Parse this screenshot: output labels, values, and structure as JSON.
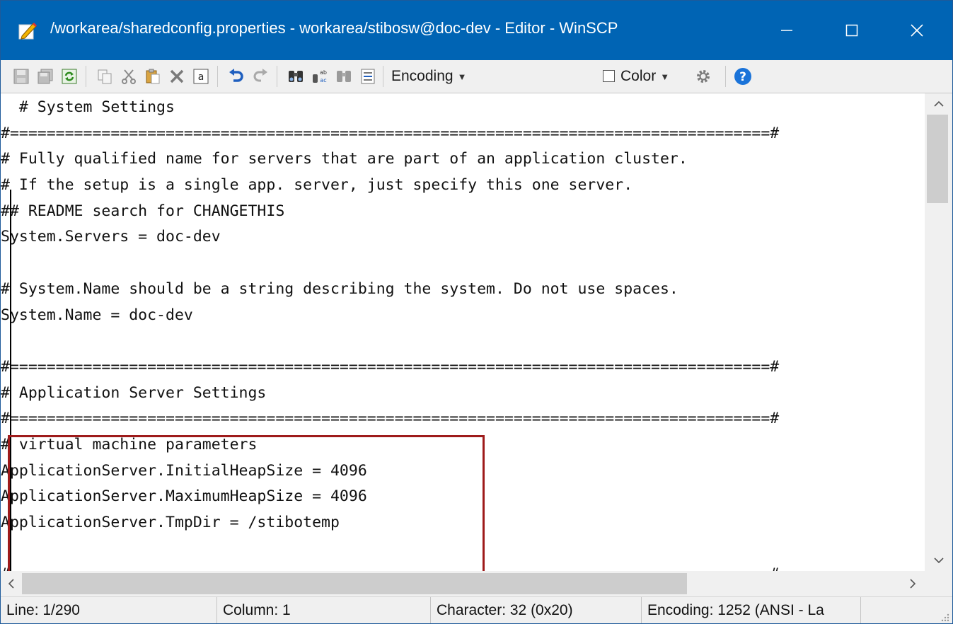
{
  "window": {
    "title": "/workarea/sharedconfig.properties - workarea/stibosw@doc-dev - Editor - WinSCP",
    "icon": "edit-pencil-icon",
    "controls": [
      "minimize-icon",
      "maximize-icon",
      "close-icon"
    ]
  },
  "toolbar": {
    "icons": [
      "save-icon",
      "save-all-icon",
      "reload-icon",
      "copy-icon",
      "cut-icon",
      "paste-icon",
      "delete-icon",
      "select-all-icon",
      "undo-icon",
      "redo-icon",
      "find-icon",
      "replace-icon",
      "find-next-icon",
      "goto-line-icon",
      "preferences-gear-icon",
      "help-icon"
    ],
    "encoding_label": "Encoding",
    "color_label": "Color"
  },
  "editor": {
    "lines": [
      "  # System Settings",
      "#===================================================================================#",
      "# Fully qualified name for servers that are part of an application cluster.",
      "# If the setup is a single app. server, just specify this one server.",
      "## README search for CHANGETHIS",
      "System.Servers = doc-dev",
      "",
      "# System.Name should be a string describing the system. Do not use spaces.",
      "System.Name = doc-dev",
      "",
      "#===================================================================================#",
      "# Application Server Settings",
      "#===================================================================================#",
      "# virtual machine parameters",
      "ApplicationServer.InitialHeapSize = 4096",
      "ApplicationServer.MaximumHeapSize = 4096",
      "ApplicationServer.TmpDir = /stibotemp",
      "",
      "#===================================================================================#"
    ],
    "highlight_color": "#9e1b1b"
  },
  "statusbar": {
    "line": "Line: 1/290",
    "column": "Column: 1",
    "character": "Character: 32 (0x20)",
    "encoding": "Encoding: 1252  (ANSI - La"
  },
  "colors": {
    "titlebar": "#0064b4",
    "help_icon": "#1a73d9"
  }
}
